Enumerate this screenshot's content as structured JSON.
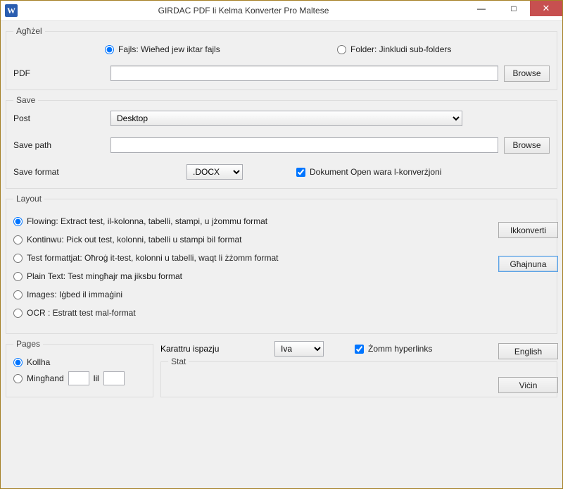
{
  "window": {
    "title": "GIRDAC PDF li Kelma Konverter Pro Maltese"
  },
  "titlebar": {
    "min": "—",
    "max": "□",
    "close": "✕"
  },
  "aghzel": {
    "legend": "Agħżel",
    "radio_files": "Fajls: Wieħed jew iktar fajls",
    "radio_folder": "Folder: Jinkludi sub-folders",
    "pdf_label": "PDF",
    "pdf_value": "",
    "browse": "Browse"
  },
  "save": {
    "legend": "Save",
    "post_label": "Post",
    "post_value": "Desktop",
    "savepath_label": "Save path",
    "savepath_value": "",
    "browse": "Browse",
    "format_label": "Save format",
    "format_value": ".DOCX",
    "open_after": "Dokument Open wara l-konverżjoni"
  },
  "layout": {
    "legend": "Layout",
    "flowing": "Flowing: Extract test, il-kolonna, tabelli, stampi, u jżommu format",
    "kontinwu": "Kontinwu: Pick out test, kolonni, tabelli u stampi bil format",
    "formatted": "Test formattjat: Oħroġ it-test, kolonni u tabelli, waqt li żżomm format",
    "plain": "Plain Text: Test mingħajr ma jiksbu format",
    "images": "Images: Iġbed il immaġini",
    "ocr": "OCR :  Estratt test mal-format"
  },
  "buttons": {
    "convert": "Ikkonverti",
    "help": "Għajnuna",
    "english": "English",
    "close": "Viċin"
  },
  "pages": {
    "legend": "Pages",
    "all": "Kollha",
    "from_label": "Mingħand",
    "from": "",
    "to_label": "lil",
    "to": ""
  },
  "bottom": {
    "charspace_label": "Karattru ispazju",
    "charspace_value": "Iva",
    "keep_links": "Żomm hyperlinks",
    "stat": "Stat"
  }
}
